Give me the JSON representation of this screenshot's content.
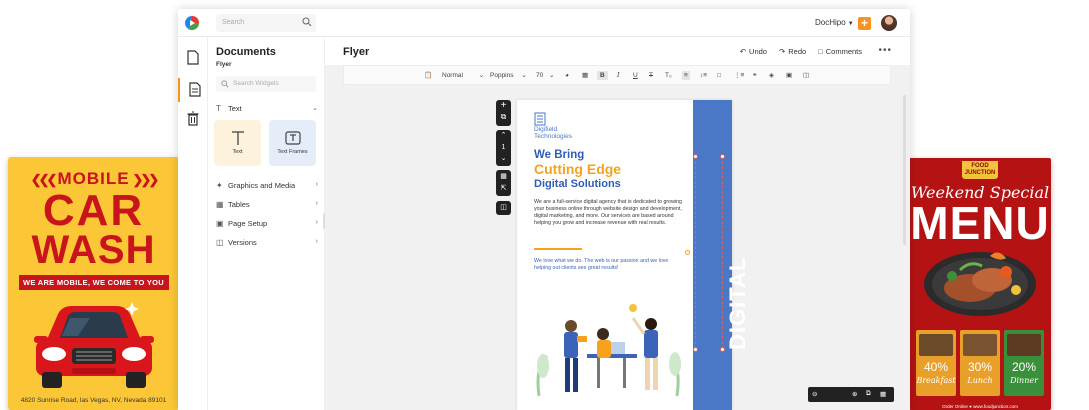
{
  "left_poster": {
    "line1": "MOBILE",
    "line2": "CAR",
    "line3": "WASH",
    "ribbon": "WE ARE MOBILE, WE COME TO YOU",
    "address": "4820 Sunrise Road, las Vegas, NV, Nevada 89101"
  },
  "right_poster": {
    "badge": "FOOD JUNCTION",
    "script_title": "Weekend Special",
    "title": "MENU",
    "cards": [
      {
        "pct": "40%",
        "meal": "Breakfast",
        "color": "#f1a628"
      },
      {
        "pct": "30%",
        "meal": "Lunch",
        "color": "#f1a628"
      },
      {
        "pct": "20%",
        "meal": "Dinner",
        "color": "#3a8f3a"
      }
    ],
    "footer": "Order Online ● www.foodjunction.com"
  },
  "topbar": {
    "search_placeholder": "Search",
    "brand": "DocHipo",
    "plus": "+"
  },
  "panel": {
    "title": "Documents",
    "subtitle": "Flyer",
    "search_placeholder": "Search Widgets",
    "text_section": "Text",
    "tile_text": "Text",
    "tile_frames": "Text Frames",
    "sections": [
      "Graphics and Media",
      "Tables",
      "Page Setup",
      "Versions"
    ]
  },
  "editor": {
    "doc_title": "Flyer",
    "undo": "Undo",
    "redo": "Redo",
    "comments": "Comments",
    "more": "•••"
  },
  "toolbar": {
    "style": "Normal",
    "font": "Poppins",
    "size": "70"
  },
  "page_tools": {
    "page_number": "1"
  },
  "flyer": {
    "logo_line1": "Digifield",
    "logo_line2": "Technologies",
    "heading1": "We Bring",
    "heading2": "Cutting Edge",
    "heading3": "Digital Solutions",
    "body": "We are a full-service digital agency that is dedicated to growing your business online through website design and development, digital marketing, and more. Our services are based around helping you grow and increase revenue with real results.",
    "body2": "We love what we do. The web is our passion and we love helping out clients see great results!",
    "vertical": "DIGITAL"
  },
  "zoom": {
    "value": "86",
    "unit": "%"
  },
  "colors": {
    "accent": "#f7931e",
    "flyer_blue": "#4a78c6",
    "flyer_orange": "#f6a21f",
    "poster_red": "#c8141b",
    "poster_yellow": "#fcc736"
  }
}
